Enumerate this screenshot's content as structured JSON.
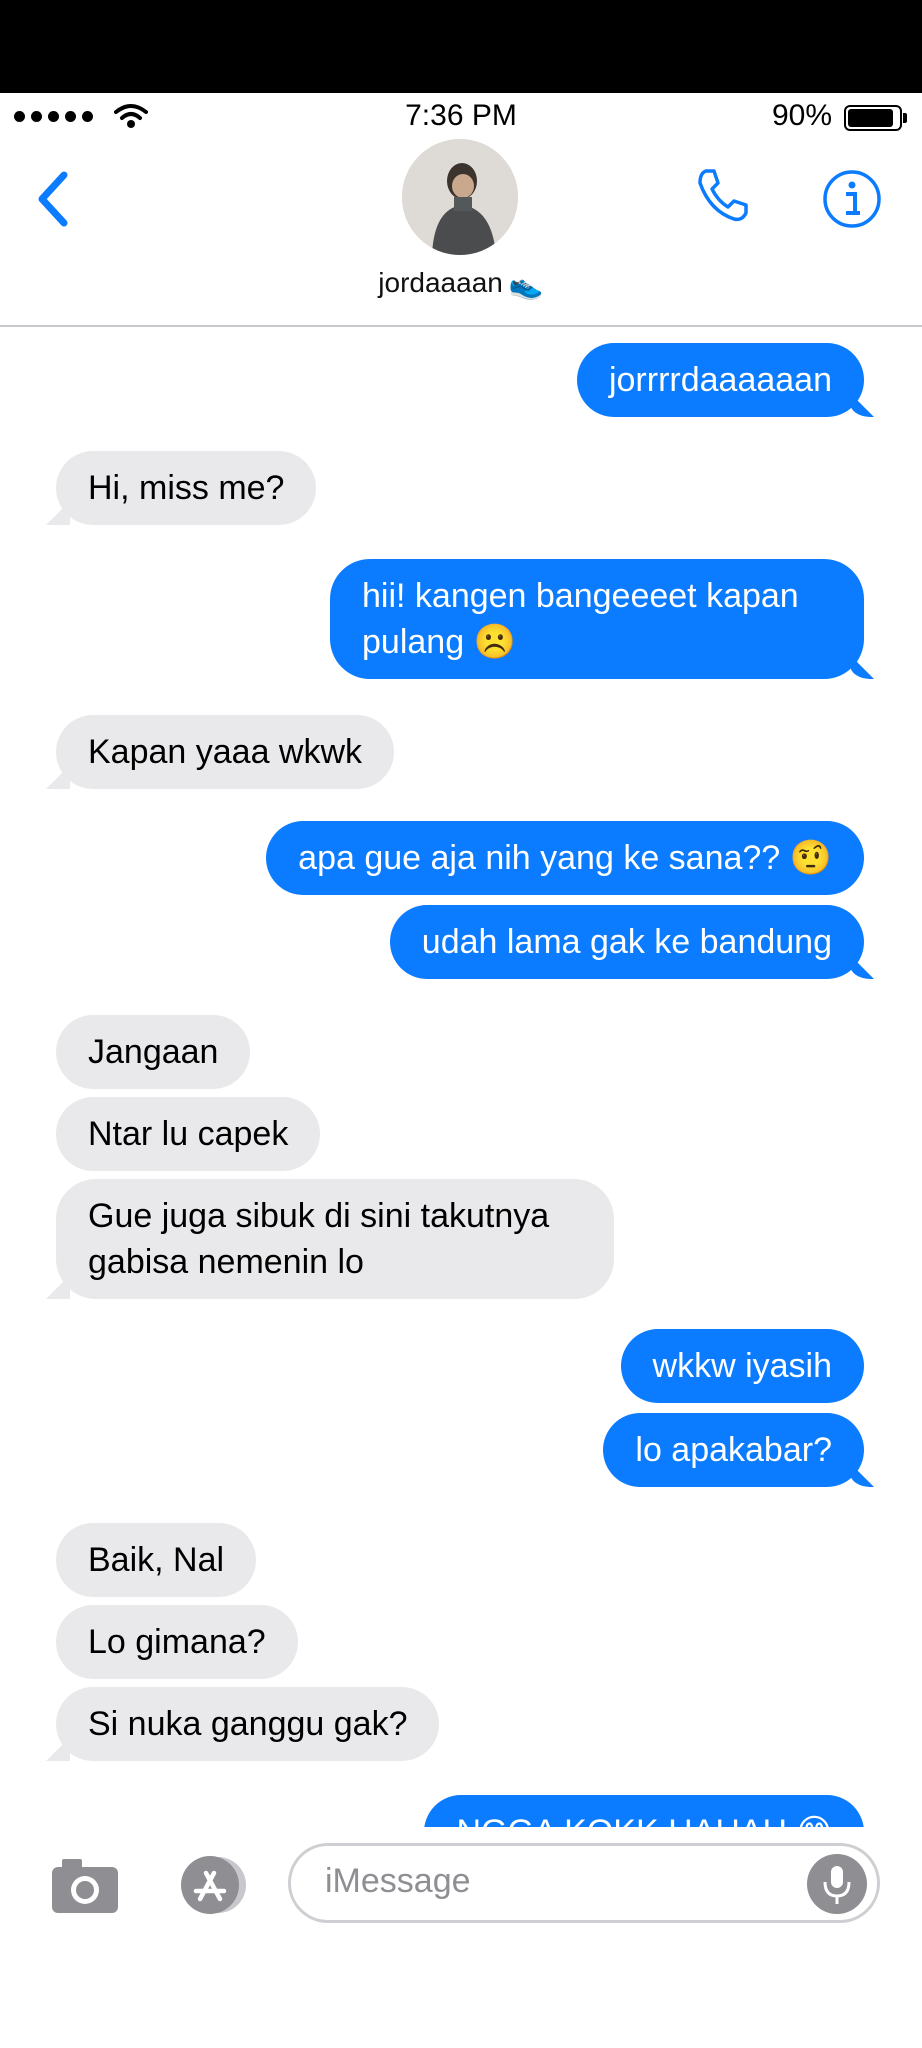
{
  "status": {
    "time": "7:36 PM",
    "battery": "90%",
    "battery_level": 0.9
  },
  "header": {
    "contact_name": "jordaaaan",
    "contact_emoji": "👟"
  },
  "messages": [
    {
      "dir": "out",
      "text": "jorrrrdaaaaaan"
    },
    {
      "dir": "in",
      "text": "Hi, miss me?"
    },
    {
      "dir": "out",
      "text": "hii! kangen bangeeeet kapan pulang ☹️"
    },
    {
      "dir": "in",
      "text": "Kapan yaaa wkwk"
    },
    {
      "dir": "out",
      "text": "apa gue aja nih yang ke sana?? 🤨"
    },
    {
      "dir": "out",
      "text": "udah lama gak ke bandung"
    },
    {
      "dir": "in",
      "text": "Jangaan"
    },
    {
      "dir": "in",
      "text": "Ntar lu capek"
    },
    {
      "dir": "in",
      "text": "Gue juga sibuk di sini takutnya gabisa nemenin lo"
    },
    {
      "dir": "out",
      "text": "wkkw iyasih"
    },
    {
      "dir": "out",
      "text": "lo apakabar?"
    },
    {
      "dir": "in",
      "text": "Baik, Nal"
    },
    {
      "dir": "in",
      "text": "Lo gimana?"
    },
    {
      "dir": "in",
      "text": "Si nuka ganggu gak?"
    },
    {
      "dir": "out",
      "text": "NGGA KOKK HAHAH 😊"
    }
  ],
  "composer": {
    "placeholder": "iMessage"
  },
  "colors": {
    "accent": "#0b7bff",
    "incoming_bubble": "#e9e9eb",
    "icon_gray": "#8e8e93"
  }
}
